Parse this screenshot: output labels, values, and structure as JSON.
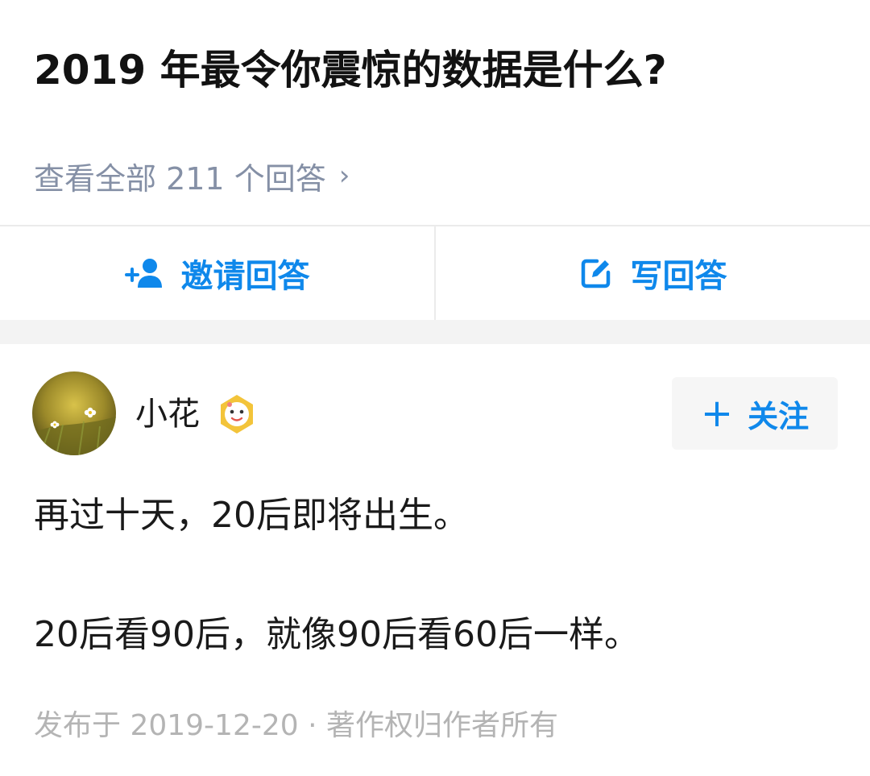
{
  "question": {
    "title": "2019 年最令你震惊的数据是什么?",
    "view_all_label": "查看全部 211 个回答"
  },
  "actions": {
    "invite_label": "邀请回答",
    "write_label": "写回答"
  },
  "answer": {
    "author_name": "小花",
    "follow_label": "关注",
    "lines": [
      "再过十天，20后即将出生。",
      "20后看90后，就像90后看60后一样。"
    ],
    "meta": "发布于 2019-12-20 · 著作权归作者所有"
  },
  "colors": {
    "accent": "#0f88eb",
    "muted_text": "#8590a6",
    "meta_text": "#b4b4b4",
    "divider": "#ebebeb",
    "gap_band": "#f3f3f3"
  },
  "icons": {
    "view_all": "chevron-right-icon",
    "invite": "add-user-icon",
    "write": "edit-icon",
    "follow": "plus-icon",
    "badge": "member-badge-icon"
  }
}
